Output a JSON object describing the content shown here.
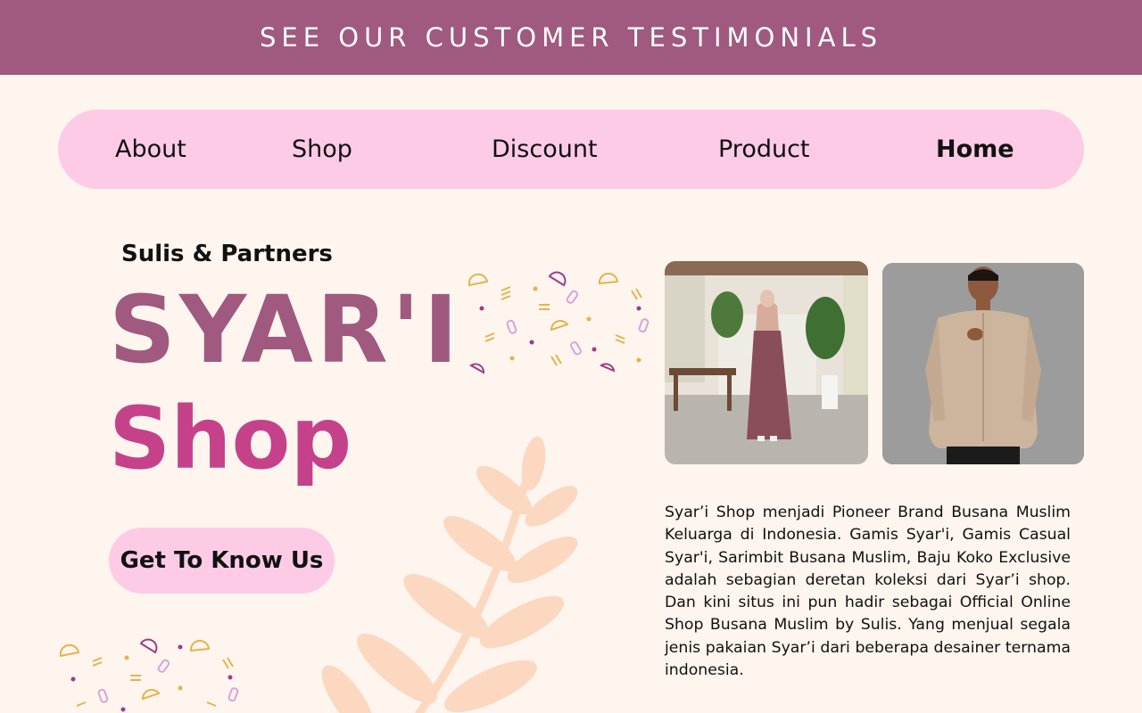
{
  "banner": {
    "link_text": "SEE OUR CUSTOMER TESTIMONIALS"
  },
  "nav": {
    "items": [
      {
        "label": "About"
      },
      {
        "label": "Shop"
      },
      {
        "label": "Discount"
      },
      {
        "label": "Product"
      },
      {
        "label": "Home",
        "active": true
      }
    ]
  },
  "hero": {
    "subtitle": "Sulis & Partners",
    "title_line1": "SYAR'I",
    "title_line2": "Shop",
    "cta_label": "Get To Know Us"
  },
  "content": {
    "description": "Syar’i Shop menjadi Pioneer Brand Busana Muslim Keluarga di Indonesia. Gamis Syar'i, Gamis Casual Syar'i, Sarimbit Busana Muslim, Baju Koko Exclusive adalah sebagian deretan koleksi dari Syar’i shop. Dan kini situs ini pun hadir sebagai Official Online Shop Busana Muslim by Sulis. Yang menjual segala jenis pakaian Syar’i dari beberapa desainer ternama indonesia."
  },
  "colors": {
    "banner_bg": "#a0597f",
    "nav_bg": "#fdcbe6",
    "page_bg": "#fdf5ee",
    "title_primary": "#a0597f",
    "title_secondary": "#c5428b",
    "leaf": "#fcd8c0"
  }
}
